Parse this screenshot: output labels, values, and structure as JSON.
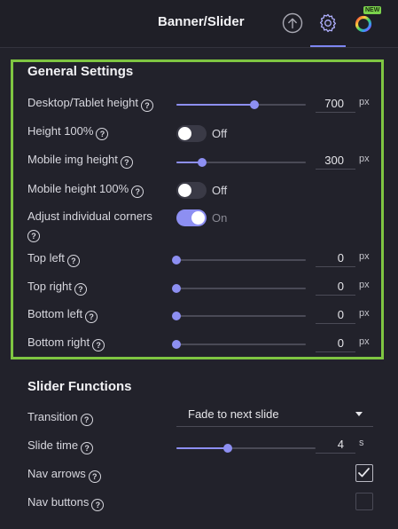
{
  "header": {
    "title": "Banner/Slider",
    "badge": "NEW",
    "icons": [
      "upload-icon",
      "gear-icon",
      "color-wheel-icon"
    ]
  },
  "general": {
    "title": "General Settings",
    "desktop_height": {
      "label": "Desktop/Tablet height",
      "value": "700",
      "unit": "px",
      "level": 0.6
    },
    "height_100": {
      "label": "Height 100%",
      "state": "Off"
    },
    "mobile_img_height": {
      "label": "Mobile img height",
      "value": "300",
      "unit": "px",
      "level": 0.2
    },
    "mobile_height_100": {
      "label": "Mobile height 100%",
      "state": "Off"
    },
    "adjust_corners": {
      "label": "Adjust individual corners",
      "state": "On"
    },
    "top_left": {
      "label": "Top left",
      "value": "0",
      "unit": "px",
      "level": 0
    },
    "top_right": {
      "label": "Top right",
      "value": "0",
      "unit": "px",
      "level": 0
    },
    "bottom_left": {
      "label": "Bottom left",
      "value": "0",
      "unit": "px",
      "level": 0
    },
    "bottom_right": {
      "label": "Bottom right",
      "value": "0",
      "unit": "px",
      "level": 0
    }
  },
  "slider_functions": {
    "title": "Slider Functions",
    "transition": {
      "label": "Transition",
      "value": "Fade to next slide"
    },
    "slide_time": {
      "label": "Slide time",
      "value": "4",
      "unit": "s",
      "level": 0.37
    },
    "nav_arrows": {
      "label": "Nav arrows",
      "checked": true
    },
    "nav_buttons": {
      "label": "Nav buttons",
      "checked": false
    }
  },
  "colors": {
    "accent": "#8d8ff2",
    "highlight_border": "#7fc642",
    "background": "#22222b"
  }
}
